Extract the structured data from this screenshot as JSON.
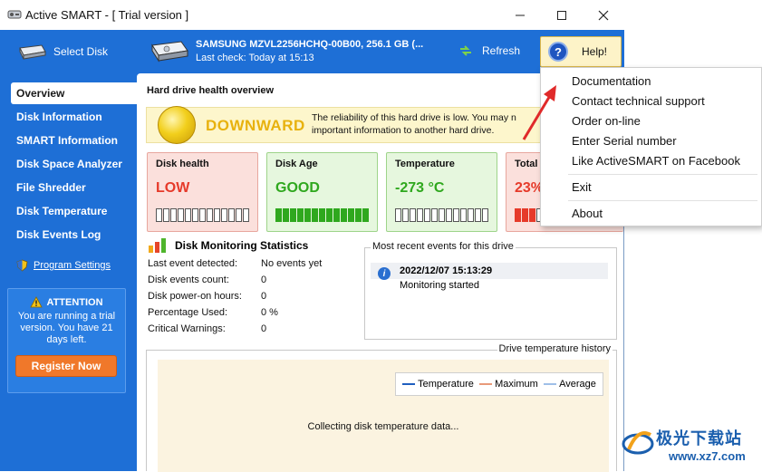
{
  "window": {
    "title": "Active SMART - [ Trial version ]"
  },
  "toolbar": {
    "select_disk": "Select Disk",
    "drive_name": "SAMSUNG MZVL2256HCHQ-00B00, 256.1 GB (...",
    "last_check": "Last check: Today at 15:13",
    "refresh": "Refresh",
    "help": "Help!"
  },
  "sidebar": {
    "items": [
      {
        "label": "Overview",
        "active": true
      },
      {
        "label": "Disk Information"
      },
      {
        "label": "SMART Information"
      },
      {
        "label": "Disk Space Analyzer"
      },
      {
        "label": "File Shredder"
      },
      {
        "label": "Disk Temperature"
      },
      {
        "label": "Disk Events Log"
      }
    ],
    "settings": "Program Settings",
    "attention_title": "ATTENTION",
    "attention_msg": "You are running a trial version. You have 21 days left.",
    "register": "Register Now"
  },
  "main": {
    "section_title": "Hard drive health overview",
    "banner": {
      "status": "DOWNWARD",
      "line1": "The reliability of this hard drive is low. You may n",
      "line2": "important information to another hard drive."
    },
    "cards": [
      {
        "label": "Disk health",
        "value": "LOW",
        "color": "#e63a2a",
        "bg": "#fbe0dc",
        "border": "#e8a79e",
        "fill": 0
      },
      {
        "label": "Disk Age",
        "value": "GOOD",
        "color": "#2fa81e",
        "bg": "#e6f7de",
        "border": "#9ed48a",
        "fill": 1.0
      },
      {
        "label": "Temperature",
        "value": "-273 °C",
        "color": "#2fa81e",
        "bg": "#e6f7de",
        "border": "#9ed48a",
        "fill": 0
      },
      {
        "label": "Total",
        "value": "23%",
        "color": "#e63a2a",
        "bg": "#fbe0dc",
        "border": "#e8a79e",
        "fill": 0.23
      }
    ],
    "stats": {
      "title": "Disk Monitoring Statistics",
      "rows": [
        {
          "k": "Last event detected:",
          "v": "No events yet"
        },
        {
          "k": "Disk events count:",
          "v": "0"
        },
        {
          "k": "Disk power-on hours:",
          "v": "0"
        },
        {
          "k": "Percentage Used:",
          "v": "0 %"
        },
        {
          "k": "Critical Warnings:",
          "v": "0"
        }
      ]
    },
    "events": {
      "title": "Most recent events for this drive",
      "date": "2022/12/07 15:13:29",
      "message": "Monitoring started"
    },
    "temperature": {
      "title": "Drive temperature history",
      "legend": [
        {
          "label": "Temperature",
          "color": "#1f5fbf"
        },
        {
          "label": "Maximum",
          "color": "#e89a7a"
        },
        {
          "label": "Average",
          "color": "#9fbfe8"
        }
      ],
      "collecting": "Collecting disk temperature data..."
    }
  },
  "help_menu": {
    "items": [
      "Documentation",
      "Contact technical support",
      "Order on-line",
      "Enter Serial number",
      "Like ActiveSMART on Facebook",
      "Exit",
      "About"
    ]
  },
  "watermark": {
    "cn": "极光下载站",
    "url": "www.xz7.com"
  }
}
